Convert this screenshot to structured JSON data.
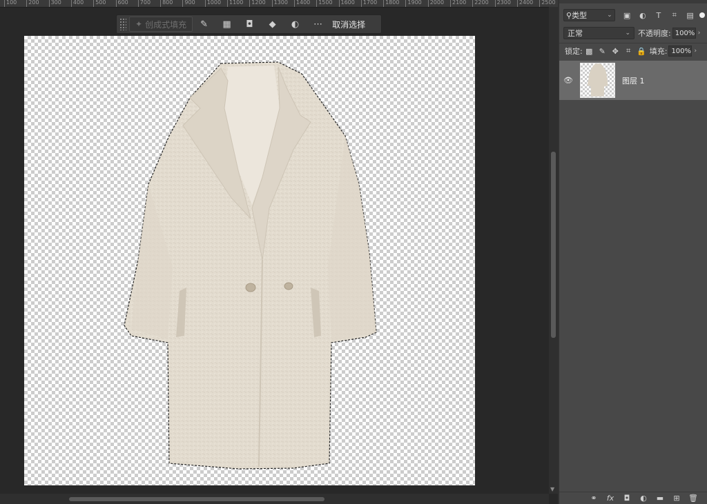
{
  "ruler": {
    "ticks": [
      "100",
      "200",
      "300",
      "400",
      "500",
      "600",
      "700",
      "800",
      "900",
      "1000",
      "1100",
      "1200",
      "1300",
      "1400",
      "1500",
      "1600",
      "1700",
      "1800",
      "1900",
      "2000",
      "2100",
      "2200",
      "2300",
      "2400",
      "2500"
    ]
  },
  "context_bar": {
    "generative_fill_label": "创成式填充",
    "deselect_label": "取消选择",
    "tools": [
      "brush-icon",
      "select-subject-icon",
      "mask-icon",
      "fill-icon",
      "adjustment-icon",
      "more-icon"
    ]
  },
  "layers_panel": {
    "filter_label": "类型",
    "filter_icons": [
      "image-filter-icon",
      "adjustment-filter-icon",
      "type-filter-icon",
      "shape-filter-icon",
      "smartobject-filter-icon"
    ],
    "blend_mode": "正常",
    "opacity_label": "不透明度:",
    "opacity_value": "100%",
    "lock_label": "锁定:",
    "lock_icons": [
      "lock-transparent-icon",
      "lock-pixels-icon",
      "lock-position-icon",
      "lock-artboard-icon",
      "lock-all-icon"
    ],
    "fill_label": "填充:",
    "fill_value": "100%",
    "layers": [
      {
        "name": "图层 1"
      }
    ],
    "bottom_icons": [
      "link-layers-icon",
      "fx-icon",
      "add-mask-icon",
      "adjustment-layer-icon",
      "group-icon",
      "new-layer-icon",
      "delete-icon"
    ]
  },
  "colors": {
    "workspace": "#282828",
    "panel": "#484848",
    "selected_layer": "#6a6a6a",
    "coat": "#e6dfd3"
  }
}
